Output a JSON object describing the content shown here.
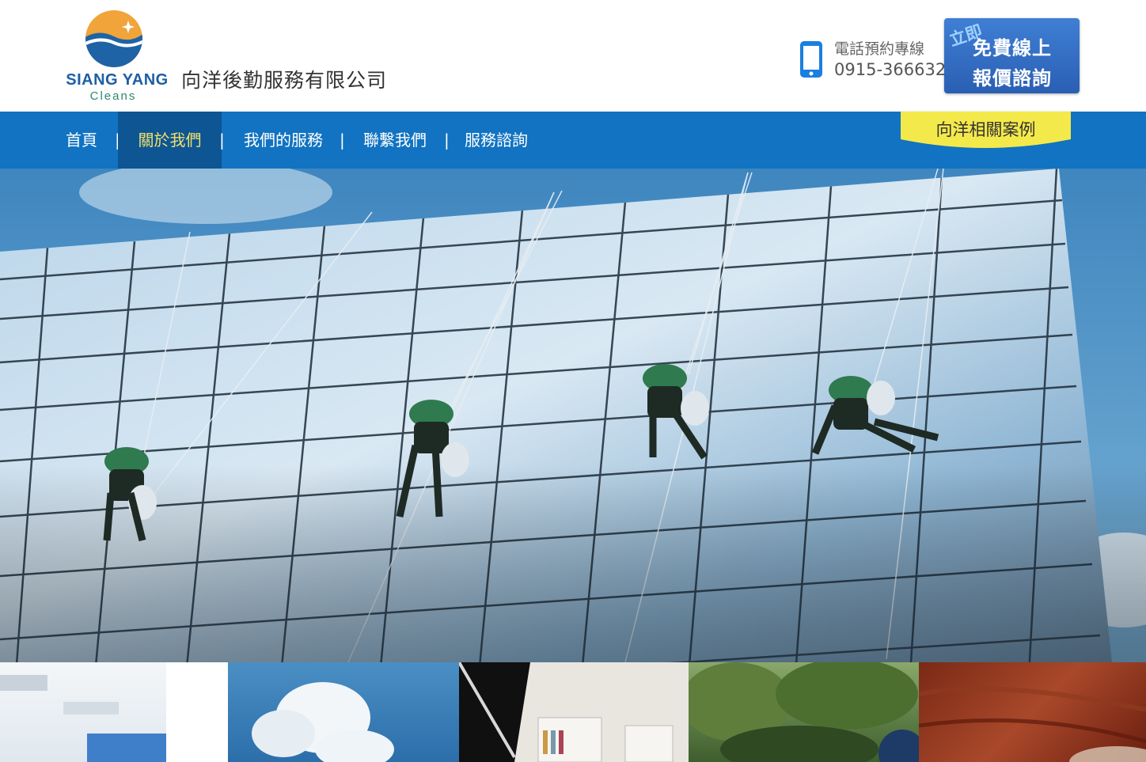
{
  "brand": {
    "wordmark": "SIANG YANG",
    "sub": "Cleans",
    "company_name": "向洋後勤服務有限公司",
    "colors": {
      "primary": "#1d5fa3",
      "accent": "#f0a43a",
      "green": "#2a8a6e"
    }
  },
  "contact": {
    "label": "電話預約專線",
    "number": "0915-366632",
    "icon": "mobile-phone-icon"
  },
  "cta": {
    "tag": "立即",
    "line1": "免費線上",
    "line2": "報價諮詢"
  },
  "nav": {
    "items": [
      {
        "label": "首頁",
        "active": false
      },
      {
        "label": "關於我們",
        "active": true
      },
      {
        "label": "我們的服務",
        "active": false
      },
      {
        "label": "聯繫我們",
        "active": false
      },
      {
        "label": "服務諮詢",
        "active": false
      }
    ],
    "separator": "|",
    "cases_tab": "向洋相關案例",
    "colors": {
      "bar": "#1173c1",
      "active_bg": "#0d5593",
      "active_text": "#f3e06a",
      "tab": "#f4e94a"
    }
  },
  "hero": {
    "subject": "window-cleaners-on-glass-facade-image"
  },
  "thumbnails": [
    "office-interior-thumbnail",
    "sky-clouds-thumbnail",
    "bookshelf-room-thumbnail",
    "garden-trees-thumbnail",
    "wood-floor-thumbnail"
  ]
}
